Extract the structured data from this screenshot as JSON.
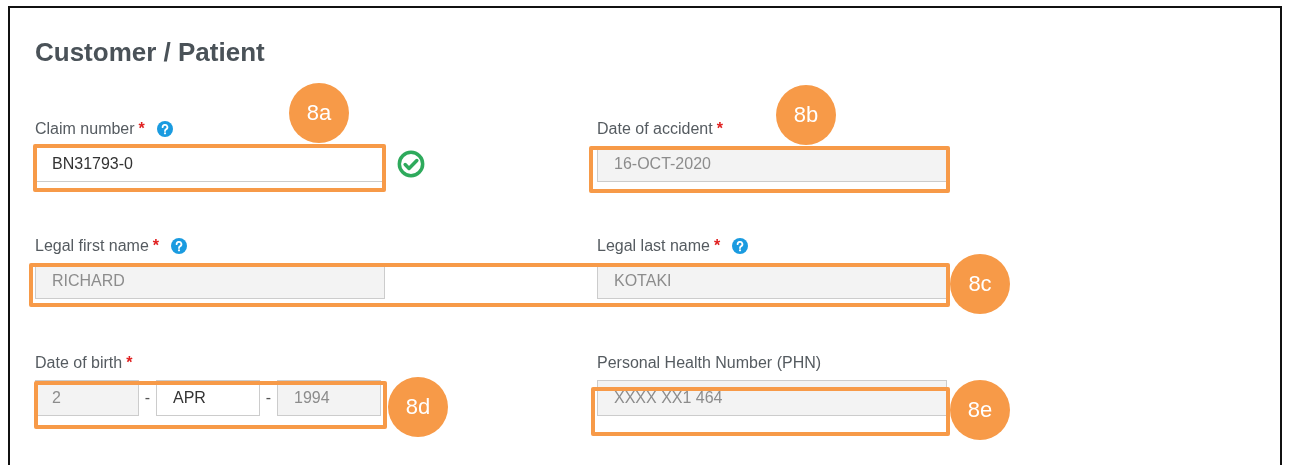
{
  "heading": "Customer / Patient",
  "fields": [
    {
      "kind": "text",
      "label": "Claim number",
      "required_mark": "*",
      "help": true,
      "value": "BN31793-0",
      "disabled": false,
      "valid": true
    },
    {
      "kind": "text",
      "label": "Date of accident",
      "required_mark": "*",
      "value": "16-OCT-2020",
      "disabled": true
    },
    {
      "kind": "text",
      "label": "Legal first name",
      "required_mark": "*",
      "help": true,
      "value": "RICHARD",
      "disabled": true
    },
    {
      "kind": "text",
      "label": "Legal last name",
      "required_mark": "*",
      "help": true,
      "value": "KOTAKI",
      "disabled": true
    },
    {
      "kind": "date",
      "label": "Date of birth",
      "required_mark": "*",
      "separators": [
        "-",
        "-"
      ],
      "parts": [
        {
          "value": "2",
          "disabled": true
        },
        {
          "value": "APR",
          "disabled": false
        },
        {
          "value": "1994",
          "disabled": true
        }
      ]
    },
    {
      "kind": "text",
      "label": "Personal Health Number (PHN)",
      "value": "XXXX XX1 464",
      "disabled": true
    }
  ],
  "annotations": [
    {
      "label": "8a"
    },
    {
      "label": "8b"
    },
    {
      "label": "8c"
    },
    {
      "label": "8d"
    },
    {
      "label": "8e"
    }
  ]
}
